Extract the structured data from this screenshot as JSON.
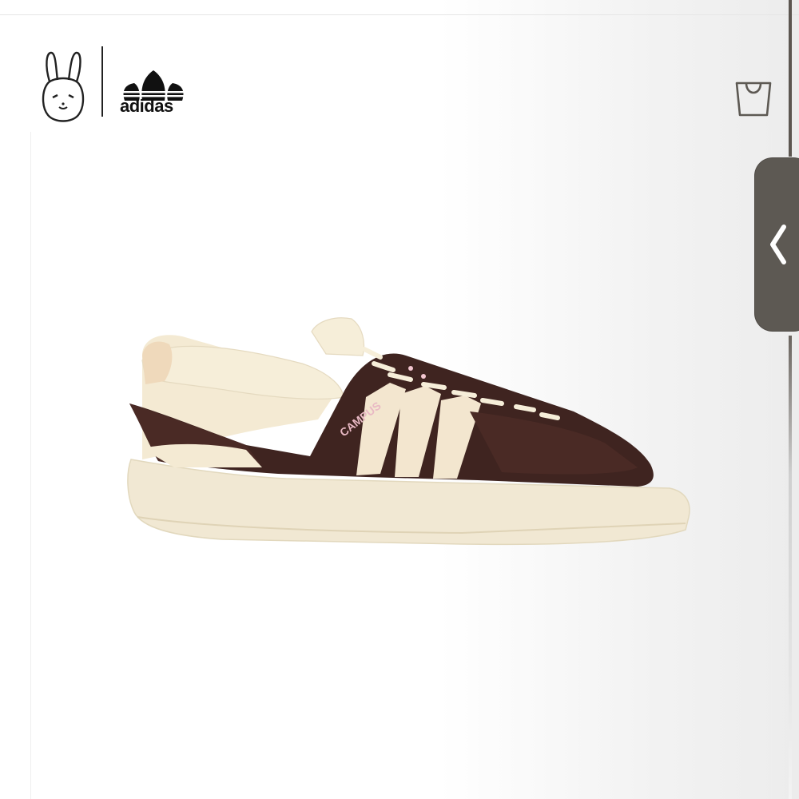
{
  "header": {
    "brand_wordmark": "adidas",
    "collab_logo_icon": "bunny-logo-icon",
    "brand_logo_icon": "trefoil-logo-icon",
    "cart_icon": "shopping-bag-icon"
  },
  "side_panel": {
    "toggle_icon": "chevron-left-icon"
  },
  "product_image": {
    "tongue_label": "CAMPUS",
    "upper_color": "#3f2420",
    "base_color": "#f2ead6"
  },
  "colors": {
    "handle": "#5d5953",
    "logo": "#111111"
  }
}
